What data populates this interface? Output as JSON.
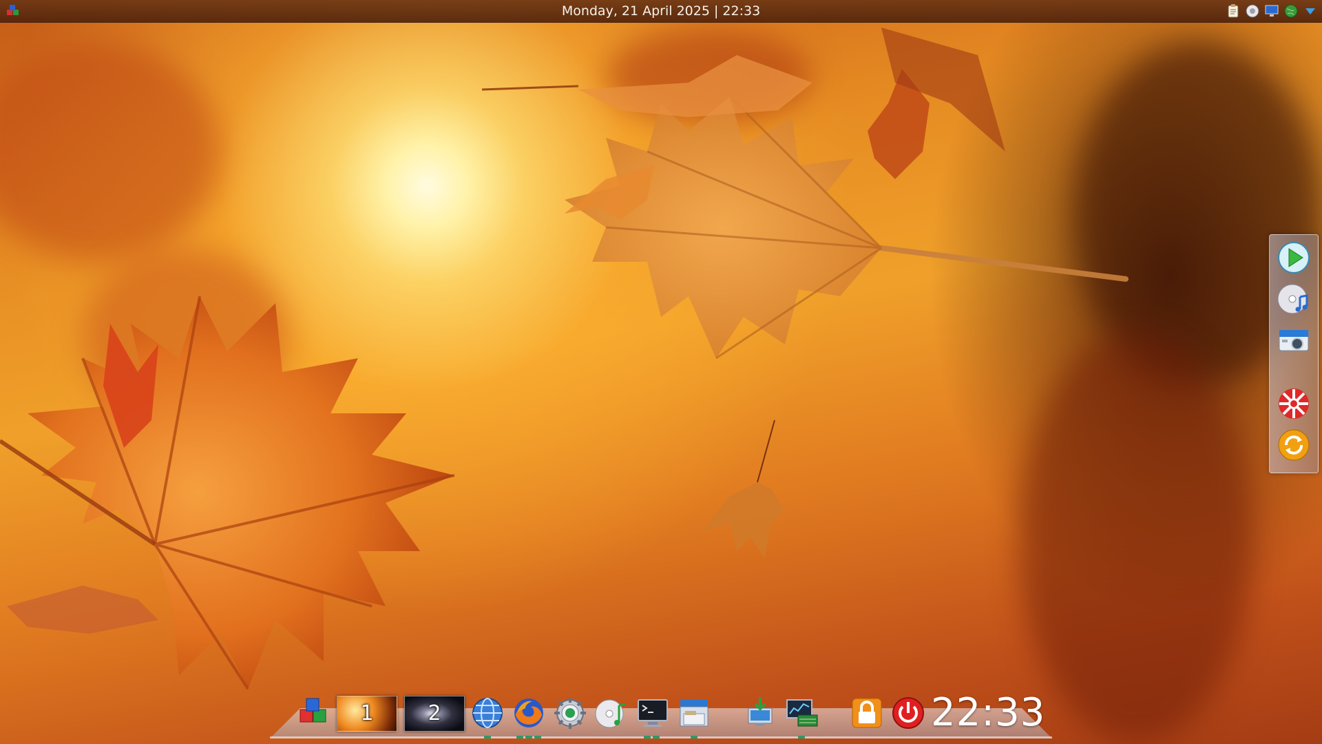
{
  "topbar": {
    "datetime": "Monday, 21 April 2025 | 22:33",
    "menu_icon": "kde-menu-icon",
    "tray_icons": [
      "clipboard-icon",
      "media-icon",
      "display-icon",
      "network-globe-icon",
      "tray-expand-arrow-icon"
    ]
  },
  "side_dock": {
    "items": [
      {
        "name": "media-player-play-icon"
      },
      {
        "name": "audio-cd-icon"
      },
      {
        "name": "camera-icon"
      },
      {
        "name": "lifesaver-help-icon"
      },
      {
        "name": "update-refresh-icon"
      }
    ]
  },
  "bottom_dock": {
    "launcher_icon": "kde-launcher-icon",
    "desktops": [
      {
        "label": "1"
      },
      {
        "label": "2"
      }
    ],
    "apps": [
      "web-browser-globe-icon",
      "firefox-icon",
      "system-settings-icon",
      "music-player-icon",
      "terminal-icon",
      "file-manager-icon",
      "download-manager-icon",
      "system-monitor-icon",
      "lock-screen-icon",
      "power-icon"
    ],
    "clock": "22:33"
  },
  "colors": {
    "accent_indicator": "#2a9a6a",
    "topbar_bg": "#6e3714",
    "wallpaper_main": "#e58a22"
  }
}
